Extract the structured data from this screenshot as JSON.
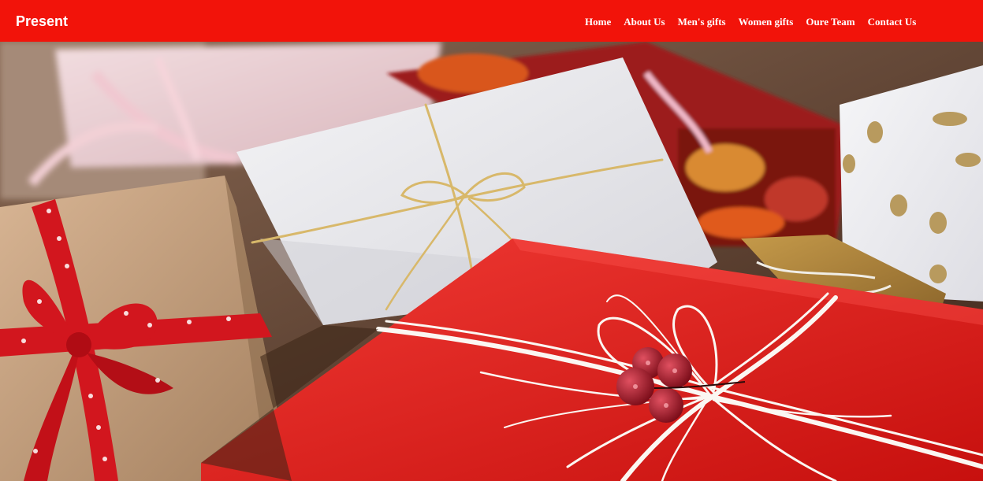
{
  "brand": {
    "name": "Present"
  },
  "nav": {
    "items": [
      {
        "label": "Home"
      },
      {
        "label": "About Us"
      },
      {
        "label": "Men's gifts"
      },
      {
        "label": "Women gifts"
      },
      {
        "label": "Oure Team"
      },
      {
        "label": "Contact Us"
      }
    ]
  },
  "colors": {
    "navbar": "#f2130a",
    "nav_text": "#ffffff"
  },
  "hero": {
    "image": "wrapped-gift-boxes-photo"
  }
}
